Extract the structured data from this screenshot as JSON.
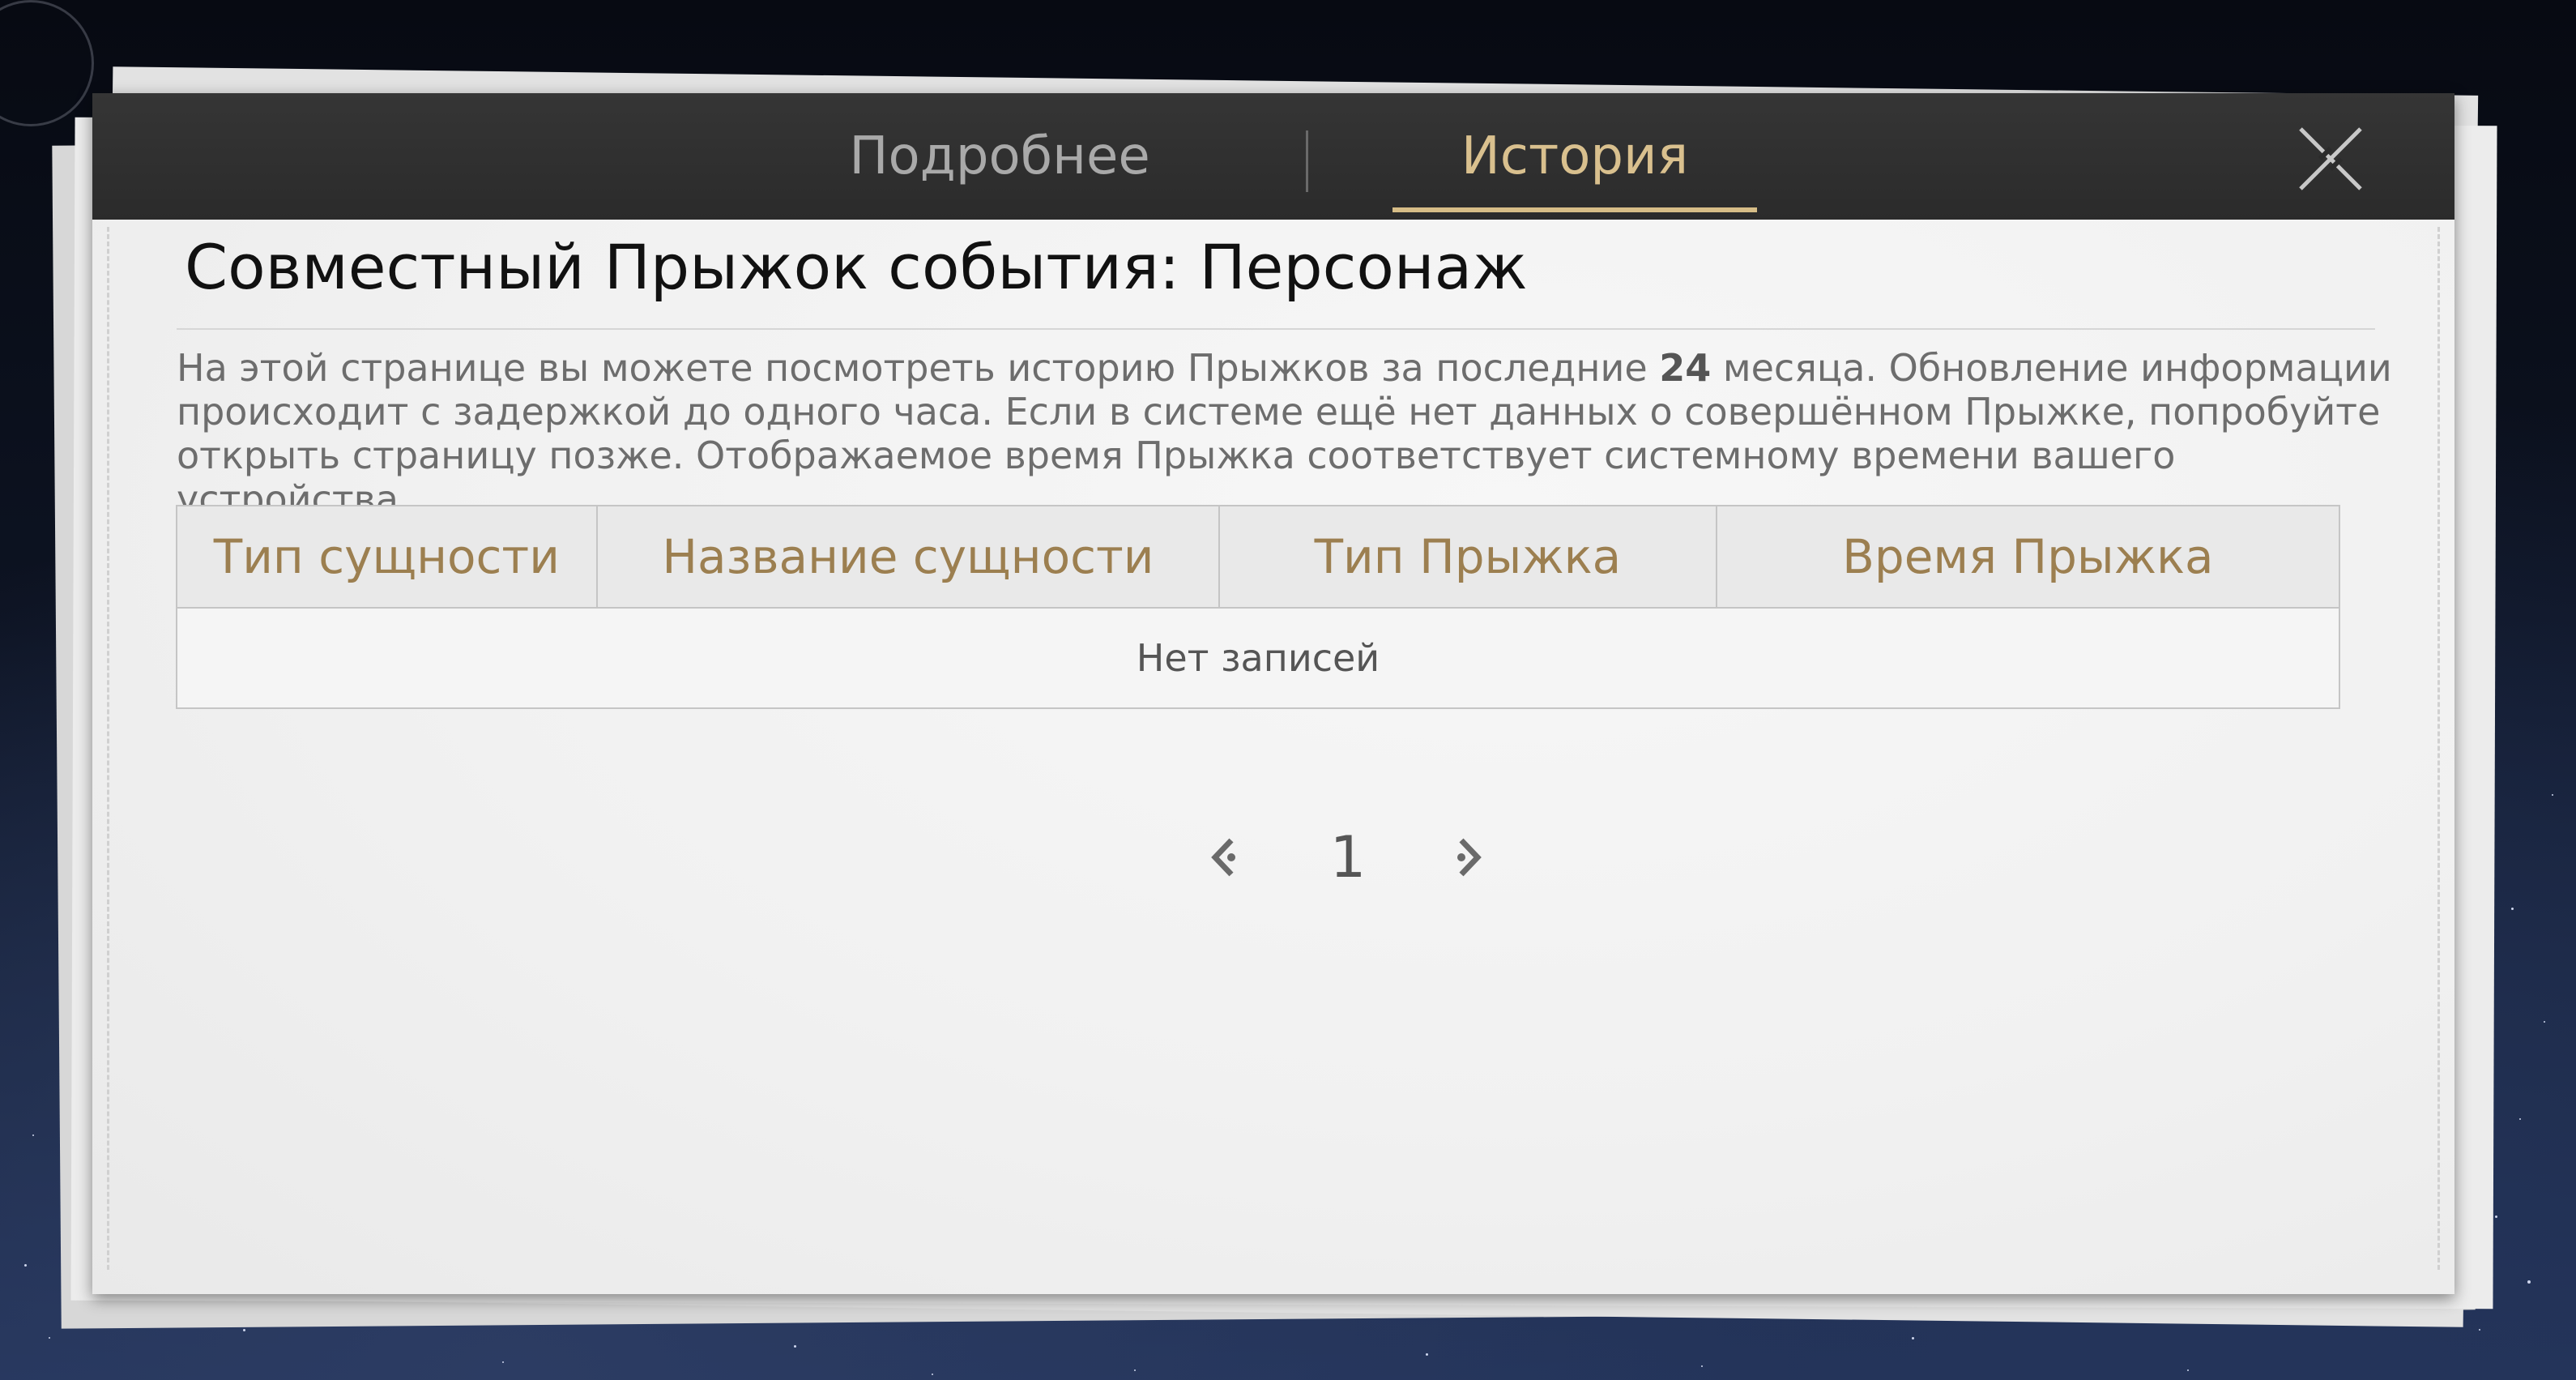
{
  "tabs": [
    {
      "label": "Подробнее",
      "active": false
    },
    {
      "label": "История",
      "active": true
    }
  ],
  "title": "Совместный Прыжок события: Персонаж",
  "description": {
    "part1": "На этой странице вы можете посмотреть историю Прыжков за последние ",
    "months": "24",
    "part2": " месяца. Обновление информации происходит с задержкой до одного часа. Если в системе ещё нет данных о совершённом Прыжке, попробуйте открыть страницу позже. Отображаемое время Прыжка соответствует системному времени вашего устройства."
  },
  "table": {
    "columns": [
      "Тип сущности",
      "Название сущности",
      "Тип Прыжка",
      "Время Прыжка"
    ],
    "empty_text": "Нет записей"
  },
  "pagination": {
    "current_page": "1"
  },
  "colors": {
    "active_tab": "#d9c08e",
    "header_text": "#9c7f50",
    "tab_bar": "#2b2b2b"
  },
  "icons": {
    "close": "close-icon",
    "prev": "chevron-left-icon",
    "next": "chevron-right-icon"
  }
}
